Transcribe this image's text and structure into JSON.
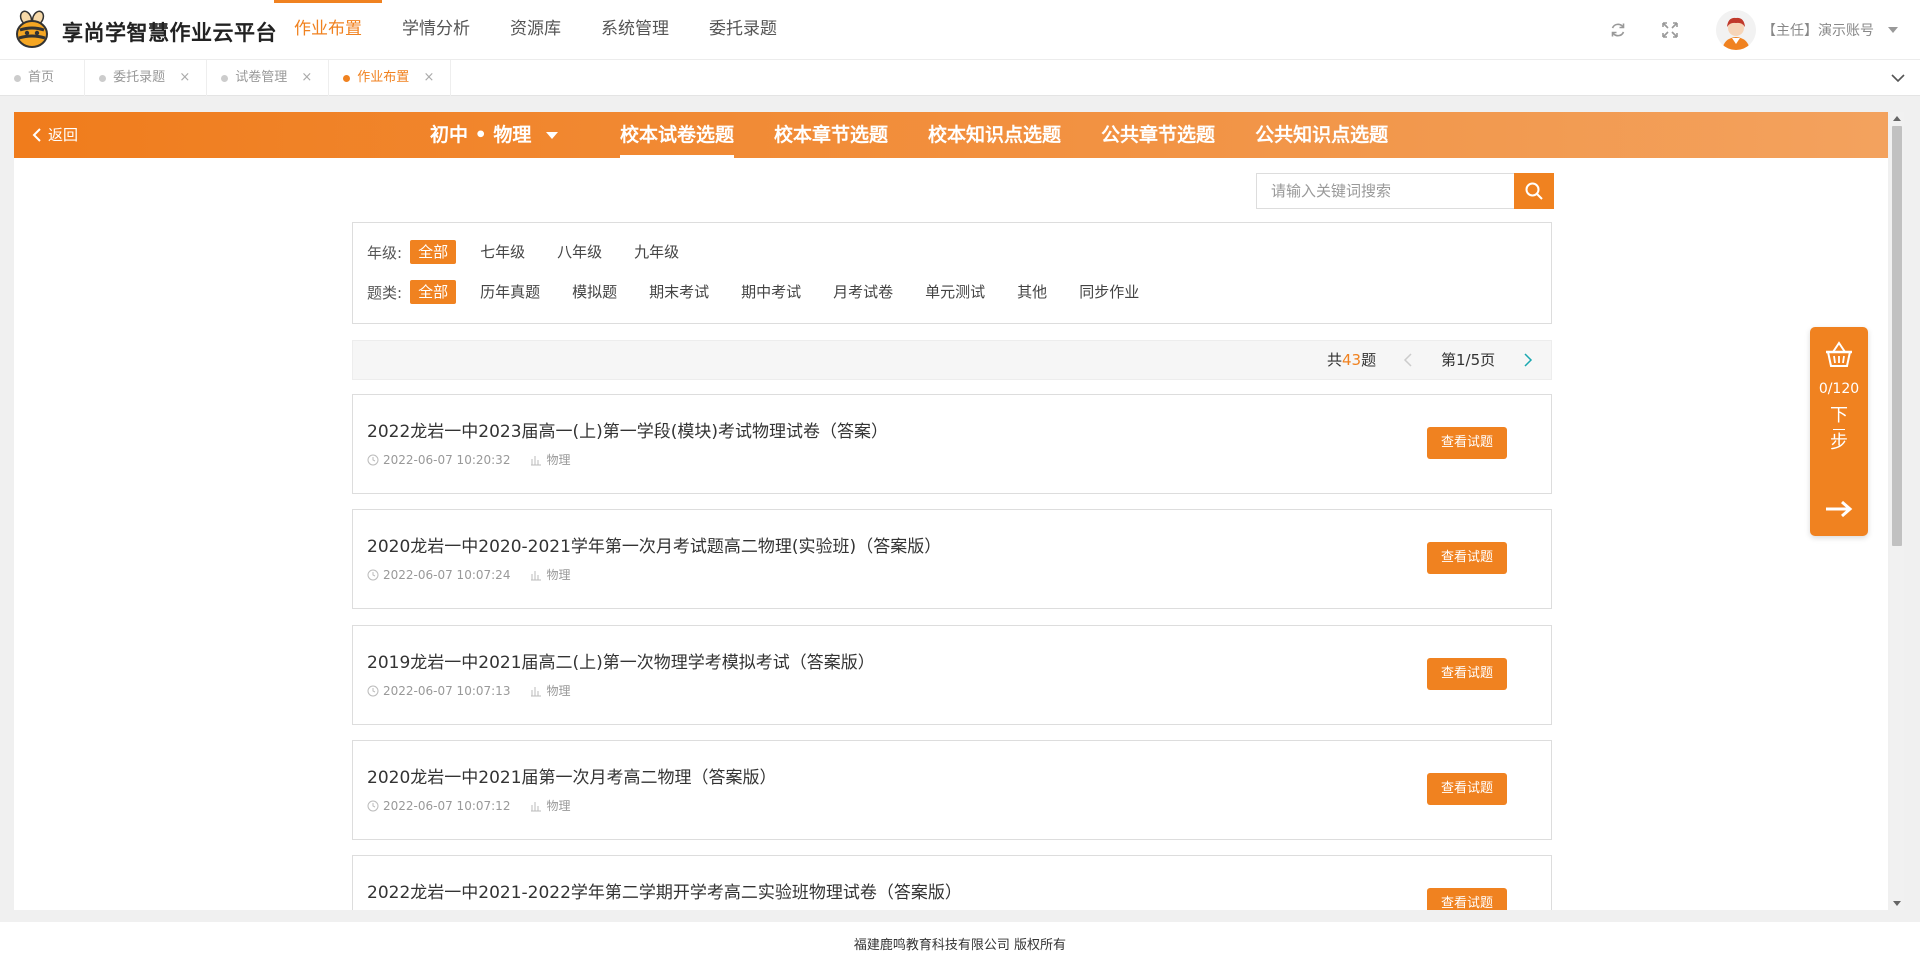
{
  "app": {
    "title": "享尚学智慧作业云平台"
  },
  "topnav": [
    {
      "label": "作业布置",
      "active": true
    },
    {
      "label": "学情分析",
      "active": false
    },
    {
      "label": "资源库",
      "active": false
    },
    {
      "label": "系统管理",
      "active": false
    },
    {
      "label": "委托录题",
      "active": false
    }
  ],
  "header_icons": [
    "refresh-icon",
    "fullscreen-icon",
    "chevron-down-icon"
  ],
  "user": {
    "name": "【主任】演示账号"
  },
  "tabs": [
    {
      "label": "首页",
      "closable": false,
      "active": false
    },
    {
      "label": "委托录题",
      "closable": true,
      "active": false
    },
    {
      "label": "试卷管理",
      "closable": true,
      "active": false
    },
    {
      "label": "作业布置",
      "closable": true,
      "active": true
    }
  ],
  "tab_close_glyph": "×",
  "panel": {
    "back_label": "返回",
    "subject": "初中 • 物理",
    "modes": [
      {
        "label": "校本试卷选题",
        "active": true
      },
      {
        "label": "校本章节选题",
        "active": false
      },
      {
        "label": "校本知识点选题",
        "active": false
      },
      {
        "label": "公共章节选题",
        "active": false
      },
      {
        "label": "公共知识点选题",
        "active": false
      }
    ],
    "search": {
      "placeholder": "请输入关键词搜索",
      "value": ""
    }
  },
  "filters": {
    "grade": {
      "label": "年级:",
      "options": [
        "全部",
        "七年级",
        "八年级",
        "九年级"
      ],
      "selected": "全部"
    },
    "type": {
      "label": "题类:",
      "options": [
        "全部",
        "历年真题",
        "模拟题",
        "期末考试",
        "期中考试",
        "月考试卷",
        "单元测试",
        "其他",
        "同步作业"
      ],
      "selected": "全部"
    }
  },
  "pager": {
    "total_prefix": "共",
    "total": "43",
    "total_suffix": "题",
    "page_info": "第1/5页"
  },
  "papers": [
    {
      "title": "2022龙岩一中2023届高一(上)第一学段(模块)考试物理试卷（答案）",
      "date": "2022-06-07 10:20:32",
      "subject": "物理",
      "button": "查看试题"
    },
    {
      "title": "2020龙岩一中2020-2021学年第一次月考试题高二物理(实验班)（答案版）",
      "date": "2022-06-07 10:07:24",
      "subject": "物理",
      "button": "查看试题"
    },
    {
      "title": "2019龙岩一中2021届高二(上)第一次物理学考模拟考试（答案版）",
      "date": "2022-06-07 10:07:13",
      "subject": "物理",
      "button": "查看试题"
    },
    {
      "title": "2020龙岩一中2021届第一次月考高二物理（答案版）",
      "date": "2022-06-07 10:07:12",
      "subject": "物理",
      "button": "查看试题"
    },
    {
      "title": "2022龙岩一中2021-2022学年第二学期开学考高二实验班物理试卷（答案版）",
      "date": "",
      "subject": "",
      "button": "查看试题"
    }
  ],
  "basket": {
    "count": "0/120",
    "next_chars": [
      "下",
      "步"
    ]
  },
  "footer": {
    "copyright": "福建鹿鸣教育科技有限公司 版权所有"
  },
  "colors": {
    "accent": "#f08220",
    "accent_light": "#f3a25e"
  }
}
